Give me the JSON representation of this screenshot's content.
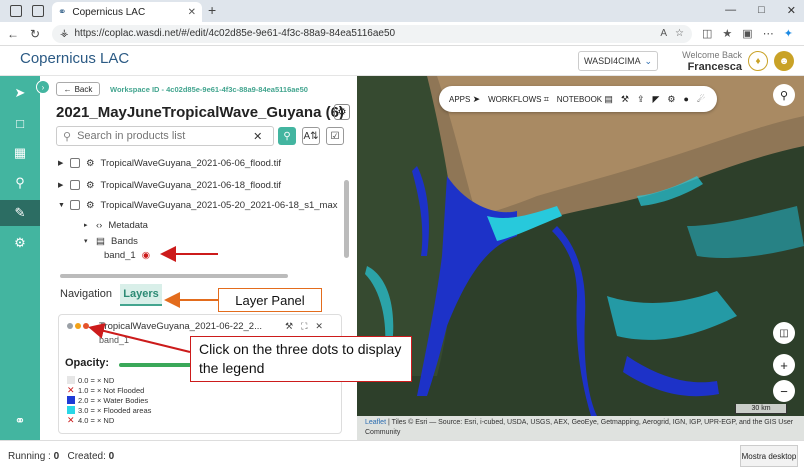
{
  "browser": {
    "tab_title": "Copernicus LAC",
    "url": "https://coplac.wasdi.net/#/edit/4c02d85e-9e61-4f3c-88a9-84ea5116ae50"
  },
  "header": {
    "logo_text": "Copernicus LAC",
    "workspace_select": "WASDI4CIMA",
    "welcome_line1": "Welcome Back",
    "welcome_user": "Francesca"
  },
  "panel": {
    "back_label": "Back",
    "workspace_id": "Workspace ID - 4c02d85e-9e61-4f3c-88a9-84ea5116ae50",
    "workspace_title": "2021_MayJuneTropicalWave_Guyana (6)",
    "search_placeholder": "Search in products list",
    "products": [
      "TropicalWaveGuyana_2021-06-06_flood.tif",
      "TropicalWaveGuyana_2021-06-18_flood.tif",
      "TropicalWaveGuyana_2021-05-20_2021-06-18_s1_max"
    ],
    "metadata_label": "Metadata",
    "bands_label": "Bands",
    "band_name": "band_1",
    "tabs": {
      "navigation": "Navigation",
      "layers": "Layers"
    },
    "layer": {
      "name": "TropicalWaveGuyana_2021-06-22_2...",
      "band": "band_1",
      "opacity_label": "Opacity:"
    },
    "legend": [
      {
        "label": "0.0 = × ND",
        "color": "#e6e6e6"
      },
      {
        "label": "1.0 = × Not Flooded",
        "color": "#ffffff",
        "crossed": true
      },
      {
        "label": "2.0 = × Water Bodies",
        "color": "#1f3bd6"
      },
      {
        "label": "3.0 = × Flooded areas",
        "color": "#2ad6e6"
      },
      {
        "label": "4.0 = × ND",
        "color": "#ffffff",
        "crossed": true
      }
    ]
  },
  "map": {
    "toolbar": {
      "apps": "APPS",
      "workflows": "WORKFLOWS",
      "notebook": "NOTEBOOK"
    },
    "scale": "30 km",
    "attribution_link": "Leaflet",
    "attribution": "| Tiles © Esri — Source: Esri, i-cubed, USDA, USGS, AEX, GeoEye, Getmapping, Aerogrid, IGN, IGP, UPR-EGP, and the GIS User Community"
  },
  "footer": {
    "running_label": "Running :",
    "running_value": "0",
    "created_label": "Created:",
    "created_value": "0",
    "desktop_button": "Mostra desktop"
  },
  "annotations": {
    "layer_panel": "Layer Panel",
    "legend_hint": "Click on the three dots to display the legend"
  },
  "colors": {
    "accent": "#43b5a0",
    "callout_orange": "#e36c1d",
    "callout_red": "#cc1b1b"
  }
}
